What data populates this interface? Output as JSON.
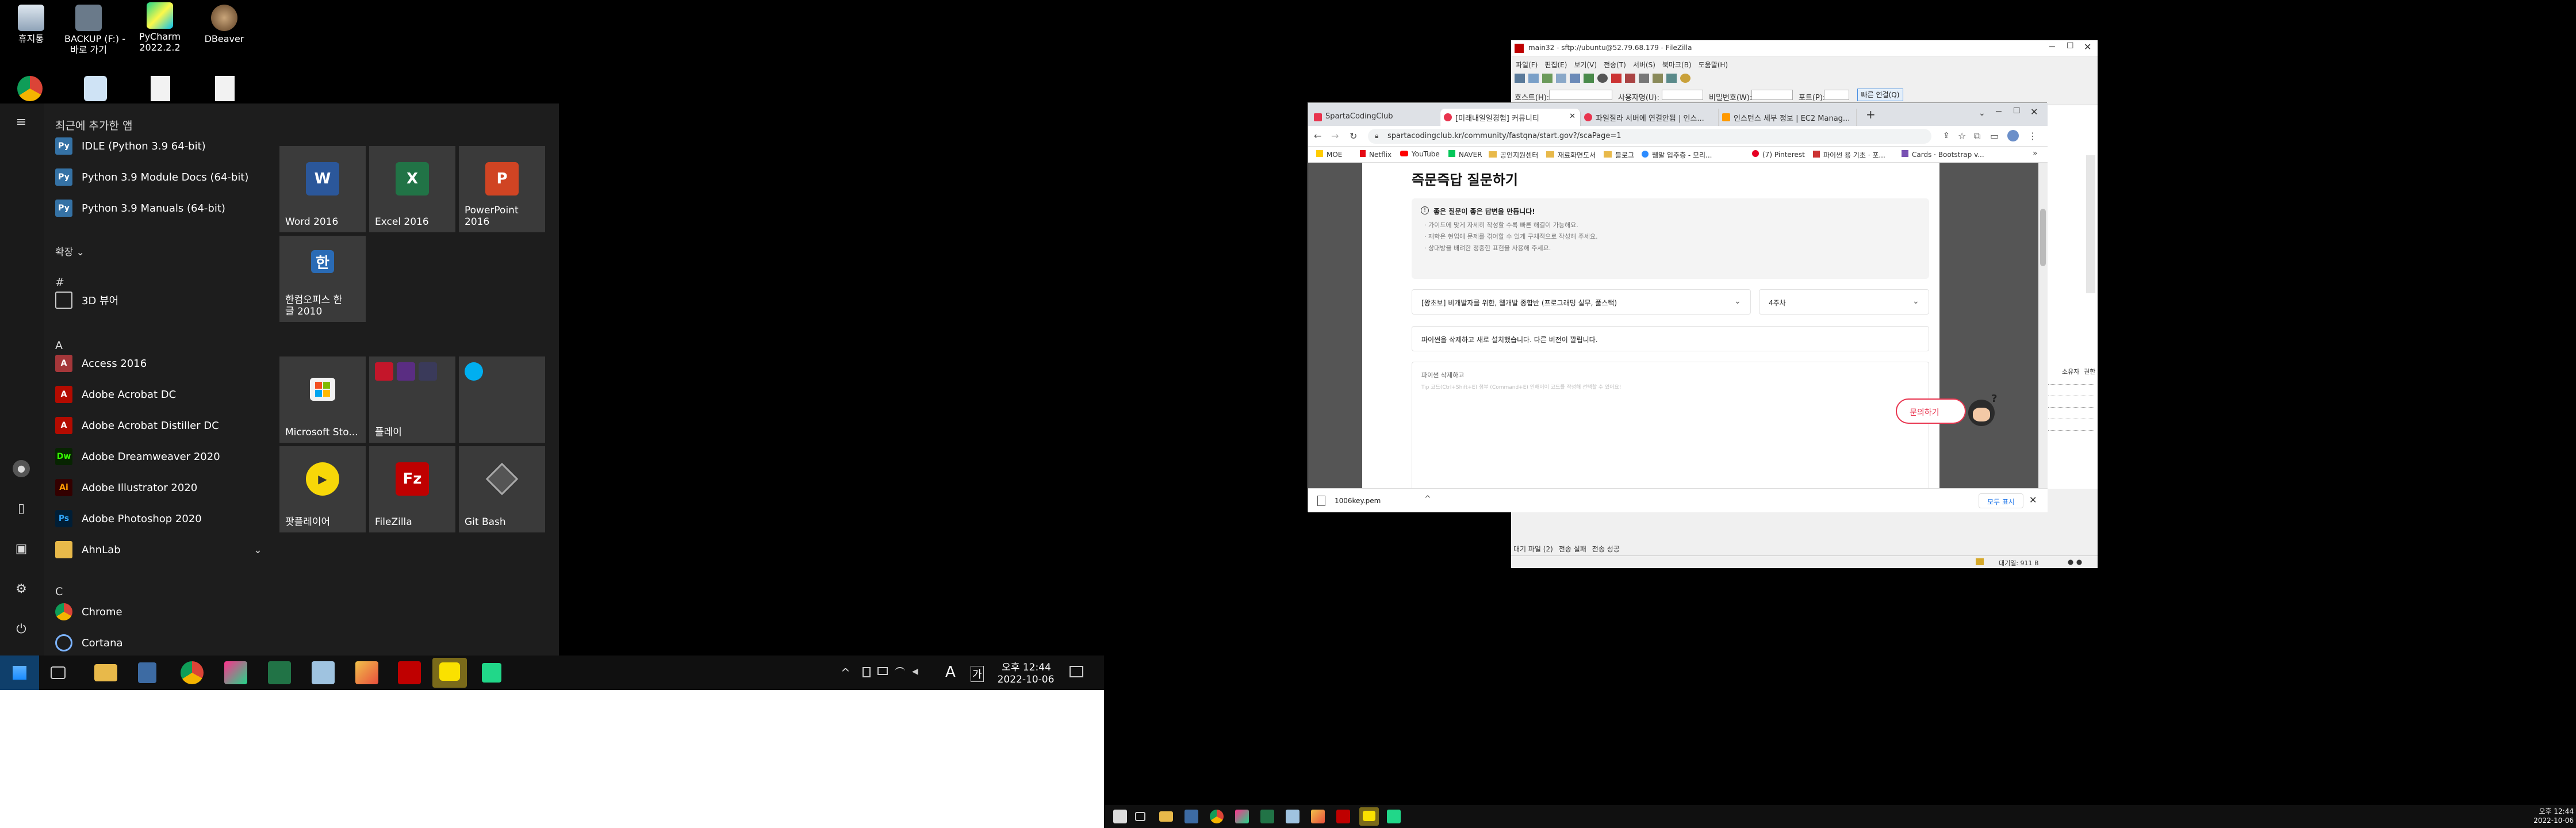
{
  "desktop": {
    "icons": [
      {
        "label": "휴지통"
      },
      {
        "label": "BACKUP (F:) -\n바로 가기"
      },
      {
        "label": "PyCharm\n2022.2.2"
      },
      {
        "label": "DBeaver"
      }
    ]
  },
  "start_menu": {
    "recent_header": "최근에 추가한 앱",
    "recent_apps": [
      "IDLE (Python 3.9 64-bit)",
      "Python 3.9 Module Docs (64-bit)",
      "Python 3.9 Manuals (64-bit)"
    ],
    "expand_label": "확장",
    "hash_header": "#",
    "hash_apps": [
      "3D 뷰어"
    ],
    "a_header": "A",
    "a_apps": [
      "Access 2016",
      "Adobe Acrobat DC",
      "Adobe Acrobat Distiller DC",
      "Adobe Dreamweaver 2020",
      "Adobe Illustrator 2020",
      "Adobe Photoshop 2020",
      "AhnLab"
    ],
    "c_header": "C",
    "c_apps": [
      "Chrome",
      "Cortana"
    ],
    "tiles": {
      "word": "Word 2016",
      "excel": "Excel 2016",
      "powerpoint": "PowerPoint\n2016",
      "hancom": "한컴오피스 한\n글 2010",
      "store": "Microsoft Sto...",
      "play": "플레이",
      "potplayer": "팟플레이어",
      "filezilla": "FileZilla",
      "gitbash": "Git Bash"
    }
  },
  "taskbar": {
    "time": "오후 12:44",
    "date": "2022-10-06",
    "ime": "A",
    "ime2": "가"
  },
  "taskbar2": {
    "time": "오후 12:44",
    "date": "2022-10-06"
  },
  "filezilla": {
    "title": "main32 - sftp://ubuntu@52.79.68.179 - FileZilla",
    "menu": [
      "파일(F)",
      "편집(E)",
      "보기(V)",
      "전송(T)",
      "서버(S)",
      "북마크(B)",
      "도움말(H)"
    ],
    "host_label": "호스트(H):",
    "user_label": "사용자명(U):",
    "pass_label": "비밀번호(W):",
    "port_label": "포트(P):",
    "connect_button": "빠른 연결(Q)",
    "bottom_tabs": [
      "대기 파일 (2)",
      "전송 실패",
      "전송 성공"
    ],
    "status": "대기열: 911 B",
    "cols": [
      "소유자",
      "권한"
    ]
  },
  "chrome": {
    "tabs": [
      "SpartaCodingClub",
      "[미래내일일경험] 커뮤니티",
      "파일질라 서버에 연결안됨 | 인스...",
      "인스턴스 세부 정보 | EC2 Manag..."
    ],
    "url": "spartacodingclub.kr/community/fastqna/start.gov?/scaPage=1",
    "bookmarks": [
      "MOE",
      "Netflix",
      "YouTube",
      "NAVER",
      "공인지원센터",
      "재료화면도서",
      "블로그",
      "웹알 입주층 - 모리...",
      "(7) Pinterest",
      "파이썬 용 기초 · 포...",
      "Cards · Bootstrap v..."
    ],
    "page_title": "즉문즉답 질문하기",
    "tip_heading": "좋은 질문이 좋은 답변을 만듭니다!",
    "tips": [
      "· 가이드에 맞게 자세히 작성할 수록 빠른 해결이 가능해요.",
      "· 재학은 현업에 문제를 겪어할 수 있게 구체적으로 작성해 주세요.",
      "· 상대방을 배려한 정중한 표현을 사용해 주세요."
    ],
    "course_select": "[왕초보] 비개발자를 위한, 웹개발 종합반 (프로그래밍 실무, 풀스택)",
    "week_select": "4주차",
    "title_input": "파이썬을 삭제하고 새로 설치했습니다. 다른 버전이 깔립니다.",
    "body_placeholder": "파이썬 삭제하고",
    "body_hint": "Tip 코드(Ctrl+Shift+E) 첨부 (Command+E) 인해이이 코드를 작성해 선택할 수 있어요!",
    "ask_button": "문의하기",
    "download_file": "1006key.pem",
    "show_all": "모두 표시"
  },
  "colors": {
    "start_bg": "#1d1d1d",
    "accent_blue": "#0078d7",
    "sparta_red": "#e8344e",
    "word": "#2b579a",
    "excel": "#217346",
    "ppt": "#d04423",
    "filezilla": "#bf0000"
  }
}
